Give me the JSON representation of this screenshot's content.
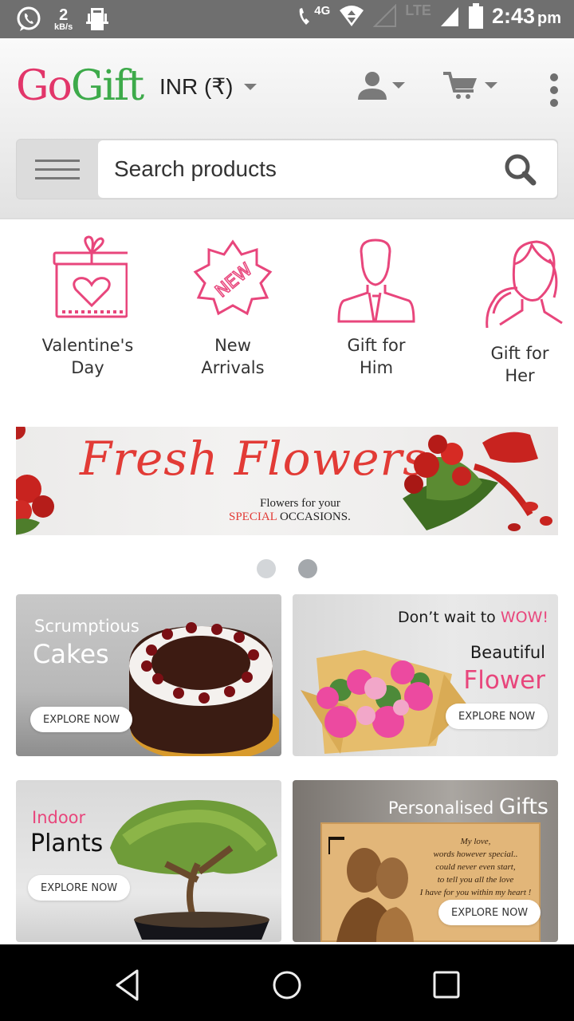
{
  "status_bar": {
    "net_speed_value": "2",
    "net_speed_unit": "kB/s",
    "call_network_label": "4G",
    "lte_label": "LTE",
    "time": "2:43",
    "ampm": "pm",
    "icons": [
      "whatsapp-icon",
      "screen-mirror-icon",
      "volte-call-icon",
      "wifi-icon",
      "signal-icon",
      "battery-icon"
    ]
  },
  "header": {
    "logo_part1": "Go",
    "logo_part2": "Gift",
    "currency": "INR (₹)",
    "account_icon": "user-icon",
    "cart_icon": "cart-icon",
    "more_icon": "more-vert-icon",
    "search": {
      "placeholder": "Search products",
      "value": ""
    }
  },
  "categories": [
    {
      "label": "Valentine's\nDay",
      "icon": "gift-heart-icon"
    },
    {
      "label": "New\nArrivals",
      "icon": "new-badge-icon"
    },
    {
      "label": "Gift for\nHim",
      "icon": "man-icon"
    },
    {
      "label": "Gift for\nHer",
      "icon": "woman-icon"
    }
  ],
  "colors": {
    "brand_pink": "#e2366a",
    "brand_green": "#3daa4a",
    "icon_pink": "#e8467c",
    "banner_red": "#e23b36"
  },
  "banner": {
    "title": "Fresh Flowers",
    "subtitle_line1": "Flowers for your",
    "subtitle_highlight": "SPECIAL",
    "subtitle_rest": " OCCASIONS.",
    "slide_count": 2,
    "active_slide": 2
  },
  "tiles": [
    {
      "line1": "Scrumptious",
      "line2": "Cakes",
      "button": "EXPLORE NOW"
    },
    {
      "line1_a": "Don’t wait to ",
      "line1_b": "WOW!",
      "line2": "Beautiful",
      "line3": "Flower",
      "button": "EXPLORE NOW"
    },
    {
      "line1": "Indoor",
      "line2": "Plants",
      "button": "EXPLORE NOW"
    },
    {
      "line1_a": "Personalised ",
      "line1_b": "Gifts",
      "button": "EXPLORE NOW",
      "plaque_text": [
        "My love,",
        "words however special..",
        "could never even start,",
        "to tell you all the love",
        "I have for you within my heart !"
      ]
    }
  ],
  "nav_bar": {
    "back": "back-icon",
    "home": "home-icon",
    "recents": "recents-icon"
  }
}
